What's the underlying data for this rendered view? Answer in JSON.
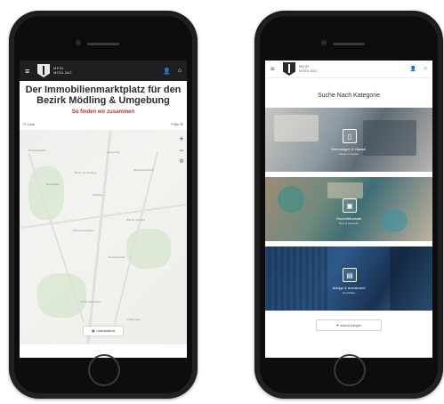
{
  "phone_left": {
    "header": {
      "menu_glyph": "≡",
      "logo_line1": "MEIN",
      "logo_line2": "MÖDLING",
      "user_glyph": "👤",
      "home_glyph": "⌂"
    },
    "hero": {
      "title": "Der Immobilienmarktplatz für den Bezirk Mödling & Umgebung",
      "subtitle": "So finden wir zusammen"
    },
    "listbar": {
      "left_label": "☷ Liste",
      "right_label": "Filter ☰"
    },
    "map": {
      "zoom_in": "+",
      "zoom_out": "−",
      "compass": "⊕",
      "labels": [
        "Laxenburg",
        "Mödling",
        "Biedermannsdorf",
        "Hinterbrühl",
        "Wiener Neudorf",
        "Guntramsdorf",
        "Perchtoldsdorf",
        "Brunn am Gebirge",
        "Maria Enzersdorf",
        "Gumpoldskirchen",
        "Traiskirchen"
      ],
      "button_label": "Listenansicht"
    }
  },
  "phone_right": {
    "header": {
      "menu_glyph": "≡",
      "logo_line1": "MEIN",
      "logo_line2": "MÖDLING",
      "user_glyph": "👤",
      "home_glyph": "⌂"
    },
    "section_title": "Suche Nach Kategorie",
    "categories": [
      {
        "label": "Wohnungen & Häuser",
        "sub": "Mieten & Kaufen",
        "icon": "▯"
      },
      {
        "label": "Geschäftslokale",
        "sub": "Büro & Gewerbe",
        "icon": "▣"
      },
      {
        "label": "Anlage & Investment",
        "sub": "Immobilien",
        "icon": "▤"
      }
    ],
    "more_button": "⚑ Inserat anlegen"
  }
}
